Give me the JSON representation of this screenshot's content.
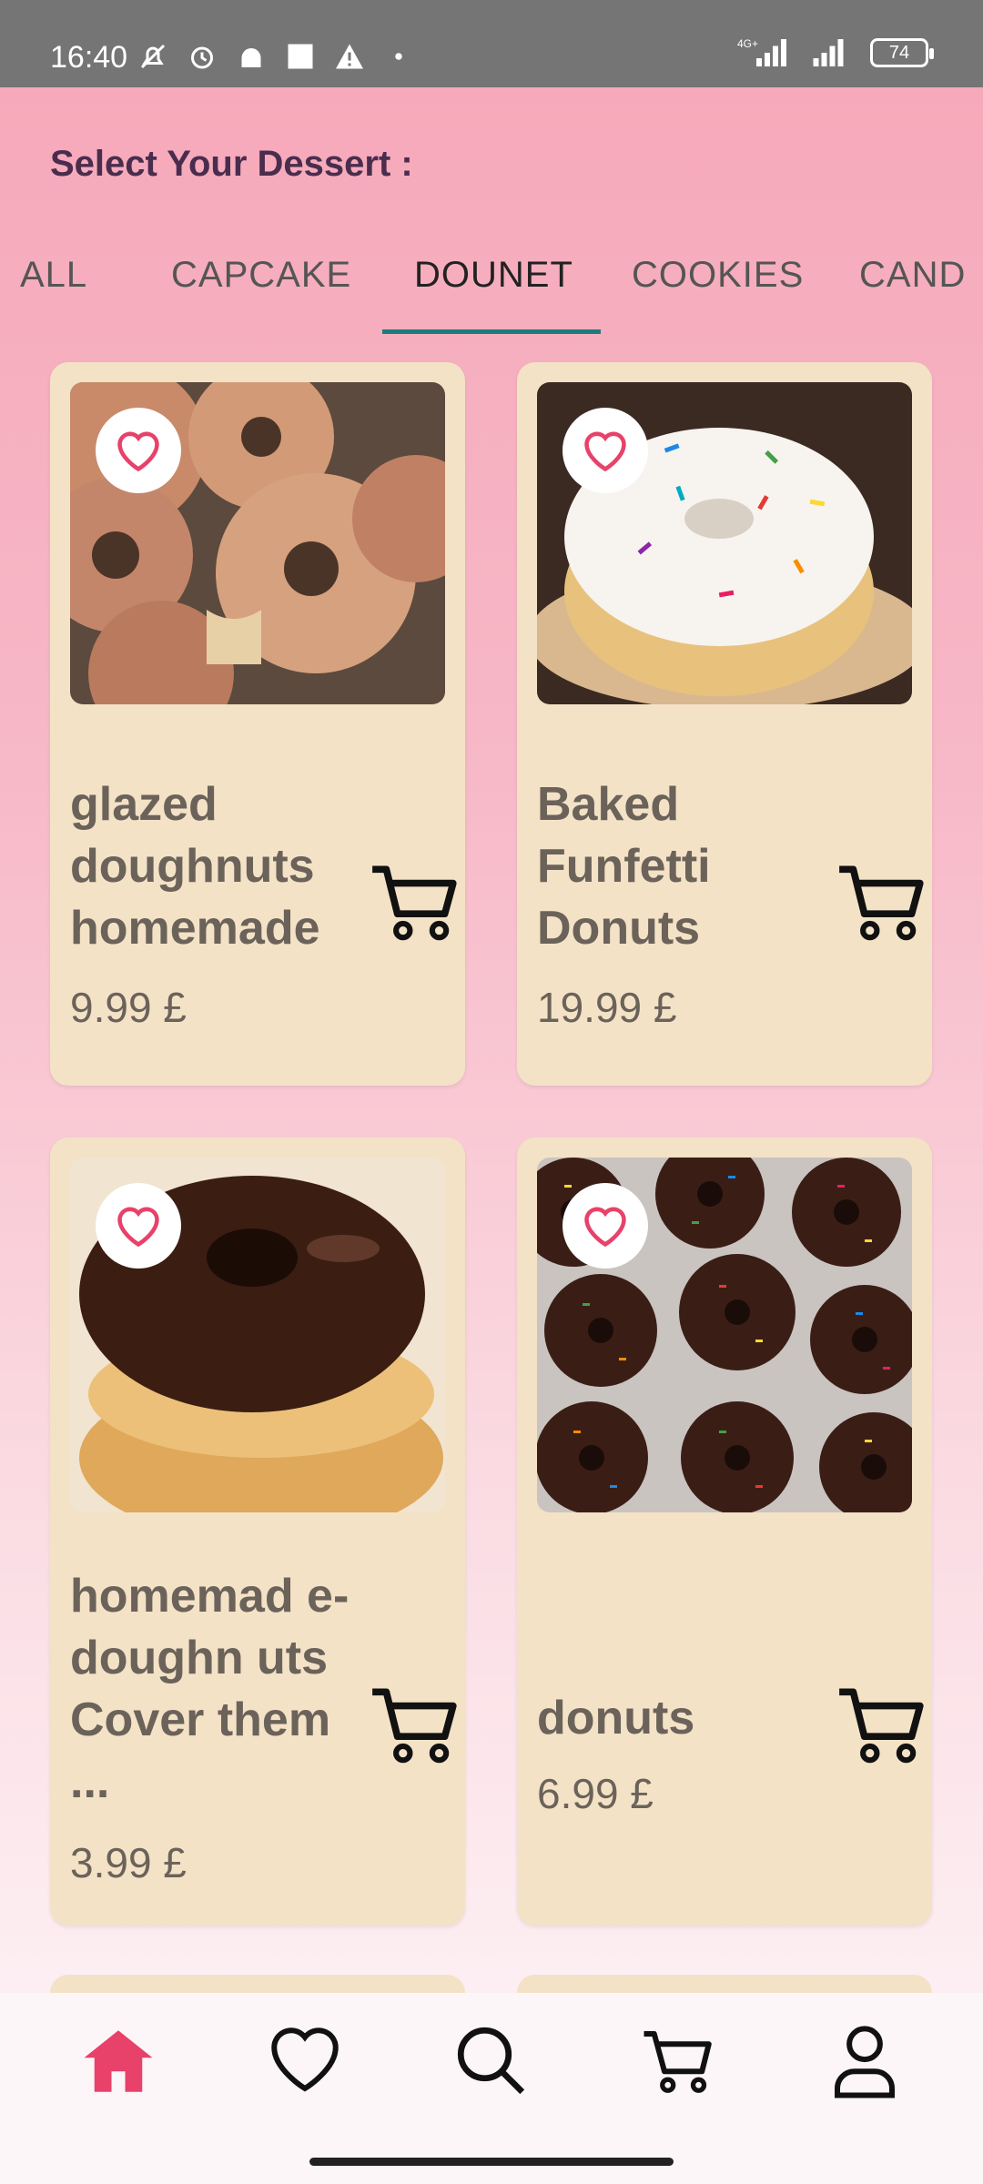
{
  "status_bar": {
    "time": "16:40",
    "battery": "74",
    "network": "4G+"
  },
  "page": {
    "title": "Select Your Dessert :"
  },
  "tabs": [
    {
      "label": "ALL",
      "active": false
    },
    {
      "label": "CAPCAKE",
      "active": false
    },
    {
      "label": "DOUNET",
      "active": true
    },
    {
      "label": "COOKIES",
      "active": false
    },
    {
      "label": "CAND",
      "active": false
    }
  ],
  "products": [
    {
      "name": "glazed doughnuts homemade",
      "price": "9.99  £",
      "favorite_icon": "heart-outline-icon",
      "cart_icon": "cart-icon"
    },
    {
      "name": "Baked Funfetti Donuts",
      "price": "19.99  £",
      "favorite_icon": "heart-outline-icon",
      "cart_icon": "cart-icon"
    },
    {
      "name": "homemad e-doughn uts Cover them ...",
      "price": "3.99  £",
      "favorite_icon": "heart-outline-icon",
      "cart_icon": "cart-icon"
    },
    {
      "name": "donuts",
      "price": "6.99  £",
      "favorite_icon": "heart-outline-icon",
      "cart_icon": "cart-icon"
    }
  ],
  "bottom_nav": [
    {
      "icon": "home-icon",
      "active": true
    },
    {
      "icon": "heart-icon",
      "active": false
    },
    {
      "icon": "search-icon",
      "active": false
    },
    {
      "icon": "cart-icon",
      "active": false
    },
    {
      "icon": "profile-icon",
      "active": false
    }
  ],
  "colors": {
    "accent": "#e8416a",
    "tab_indicator": "#1b7e7a",
    "card_bg": "#f3e2c6",
    "title": "#4a2d4e"
  }
}
